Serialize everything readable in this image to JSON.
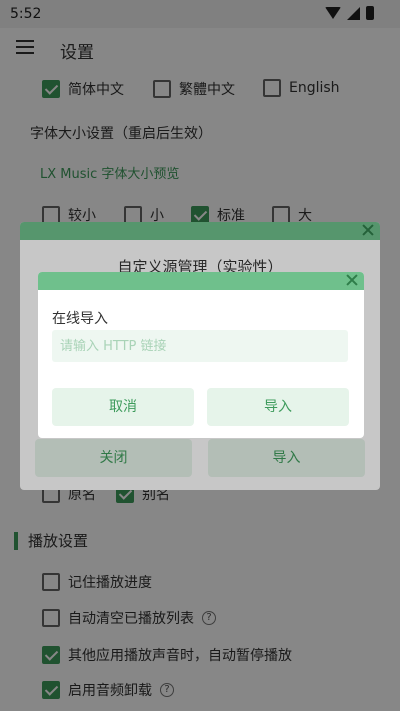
{
  "status_bar": {
    "time": "5:52",
    "icons": [
      "wifi-icon",
      "signal-icon",
      "battery-icon"
    ]
  },
  "app_bar": {
    "menu_icon": "menu-icon",
    "title": "设置"
  },
  "language": {
    "options": [
      {
        "label": "简体中文",
        "checked": true
      },
      {
        "label": "繁體中文",
        "checked": false
      },
      {
        "label": "English",
        "checked": false
      }
    ]
  },
  "font_size": {
    "label": "字体大小设置（重启后生效）",
    "preview": "LX Music 字体大小预览",
    "options": [
      {
        "label": "较小",
        "checked": false
      },
      {
        "label": "小",
        "checked": false
      },
      {
        "label": "标准",
        "checked": true
      },
      {
        "label": "大",
        "checked": false
      }
    ]
  },
  "name_display": {
    "options": [
      {
        "label": "原名",
        "checked": false
      },
      {
        "label": "别名",
        "checked": true
      }
    ]
  },
  "play_settings": {
    "title": "播放设置",
    "items": [
      {
        "label": "记住播放进度",
        "checked": false,
        "help": false
      },
      {
        "label": "自动清空已播放列表",
        "checked": false,
        "help": true
      },
      {
        "label": "其他应用播放声音时，自动暂停播放",
        "checked": true,
        "help": false
      },
      {
        "label": "启用音频卸载",
        "checked": true,
        "help": true
      }
    ]
  },
  "outer_dialog": {
    "title": "自定义源管理（实验性）",
    "close_button": "关闭",
    "import_button": "导入"
  },
  "inner_dialog": {
    "label": "在线导入",
    "input_placeholder": "请输入 HTTP 链接",
    "input_value": "",
    "cancel_button": "取消",
    "import_button": "导入"
  },
  "colors": {
    "accent": "#3e9b5c",
    "dialog_header": "#6fc08c",
    "button_bg": "#e6f4ea"
  }
}
